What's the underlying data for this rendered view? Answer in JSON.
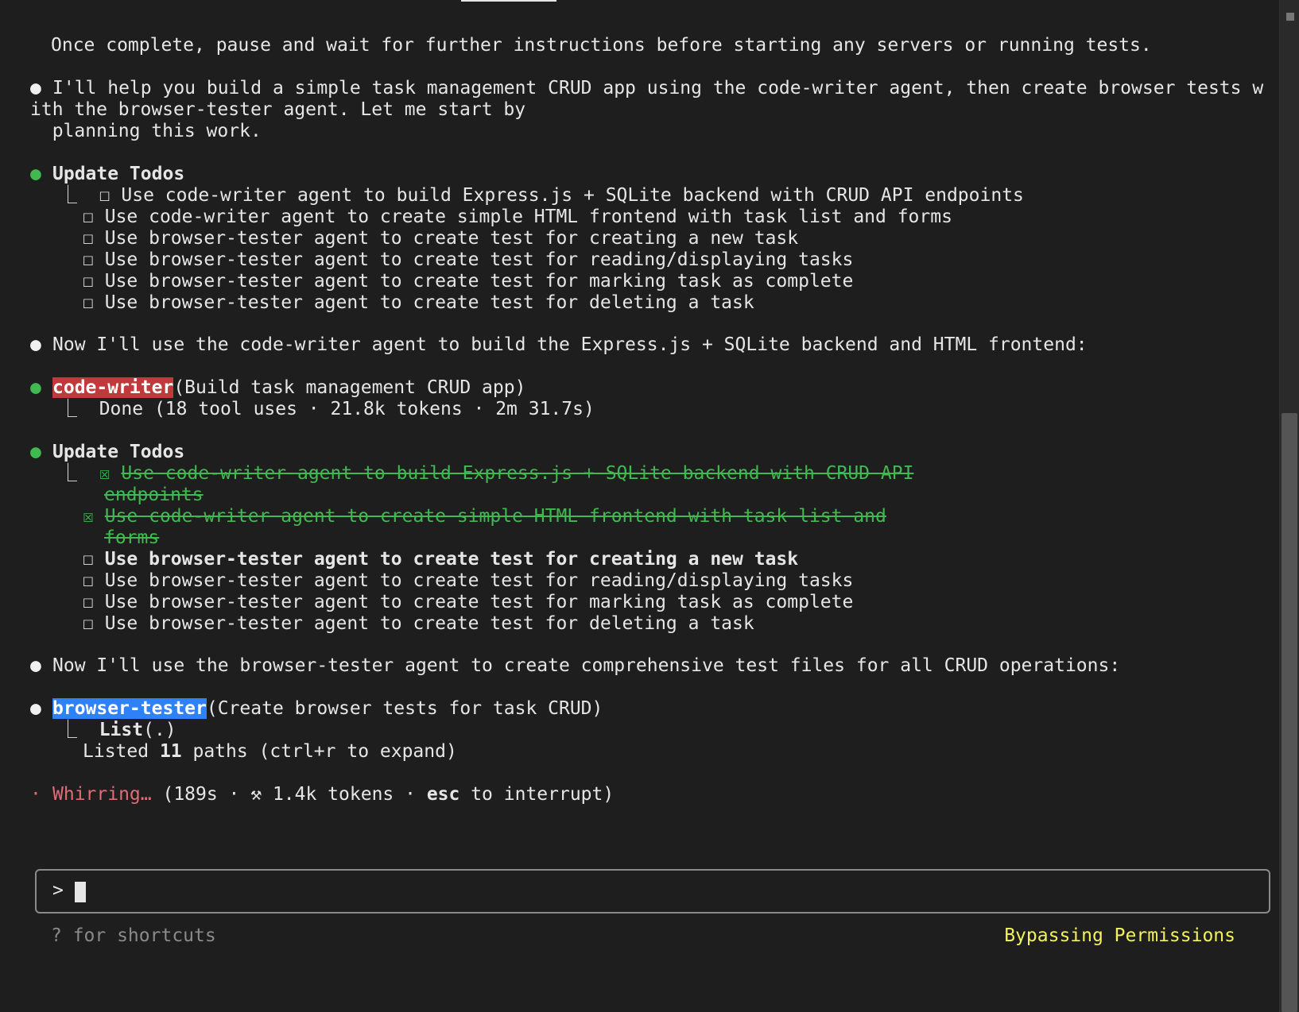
{
  "lines": {
    "intro_tail": "Once complete, pause and wait for further instructions before starting any servers or running tests.",
    "msg1_a": "I'll help you build a simple task management CRUD app using the code-writer agent, then create browser tests w",
    "msg1_b": "ith the browser-tester agent. Let me start by",
    "msg1_c": "  planning this work.",
    "todos1_title": "Update Todos",
    "todos1": [
      "Use code-writer agent to build Express.js + SQLite backend with CRUD API endpoints",
      "Use code-writer agent to create simple HTML frontend with task list and forms",
      "Use browser-tester agent to create test for creating a new task",
      "Use browser-tester agent to create test for reading/displaying tasks",
      "Use browser-tester agent to create test for marking task as complete",
      "Use browser-tester agent to create test for deleting a task"
    ],
    "msg2": "Now I'll use the code-writer agent to build the Express.js + SQLite backend and HTML frontend:",
    "agent1_name": "code-writer",
    "agent1_desc": "(Build task management CRUD app)",
    "agent1_result": "Done (18 tool uses · 21.8k tokens · 2m 31.7s)",
    "todos2_title": "Update Todos",
    "todos2_done": [
      [
        "Use code-writer agent to build Express.js + SQLite backend with CRUD API",
        "endpoints"
      ],
      [
        "Use code-writer agent to create simple HTML frontend with task list and",
        "forms"
      ]
    ],
    "todos2_active": "Use browser-tester agent to create test for creating a new task",
    "todos2_pending": [
      "Use browser-tester agent to create test for reading/displaying tasks",
      "Use browser-tester agent to create test for marking task as complete",
      "Use browser-tester agent to create test for deleting a task"
    ],
    "msg3": "Now I'll use the browser-tester agent to create comprehensive test files for all CRUD operations:",
    "agent2_name": "browser-tester",
    "agent2_desc": "(Create browser tests for task CRUD)",
    "agent2_tool": "List",
    "agent2_tool_arg": "(.)",
    "agent2_listed_pre": "Listed ",
    "agent2_listed_count": "11",
    "agent2_listed_post": " paths (ctrl+r to expand)",
    "status_word": "Whirring…",
    "status_pre": " (189s · ⚒ 1.4k tokens · ",
    "status_key": "esc",
    "status_post": " to interrupt)"
  },
  "glyphs": {
    "bullet": "●",
    "status_dot": "·",
    "tree": "⎿",
    "box_empty": "☐",
    "box_checked": "☒"
  },
  "input": {
    "prompt": ">",
    "value": ""
  },
  "footer": {
    "shortcuts_hint": "? for shortcuts",
    "mode": "Bypassing Permissions"
  },
  "colors": {
    "background": "#1e1e1e",
    "green": "#3fb950",
    "red_tag": "#c0393b",
    "blue_tag": "#2f81f7",
    "status_red": "#e06c75",
    "mode_yellow": "#f2f25a"
  }
}
